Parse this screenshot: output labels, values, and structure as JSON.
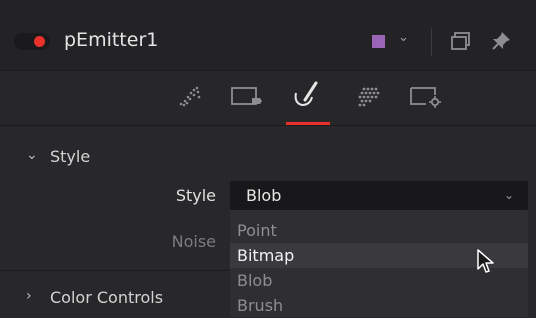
{
  "header": {
    "node_name": "pEmitter1",
    "swatch_color": "#9a65b6",
    "toggle_color": "#e8312a"
  },
  "tabs": [
    {
      "icon": "particles-icon",
      "active": false
    },
    {
      "icon": "region-icon",
      "active": false
    },
    {
      "icon": "brush-icon",
      "active": true
    },
    {
      "icon": "sets-icon",
      "active": false
    },
    {
      "icon": "settings-icon",
      "active": false
    }
  ],
  "style_section": {
    "title": "Style",
    "style_label": "Style",
    "style_value": "Blob",
    "noise_label": "Noise",
    "options": [
      "Point",
      "Bitmap",
      "Blob",
      "Brush"
    ],
    "highlighted": "Bitmap"
  },
  "color_section": {
    "title": "Color Controls"
  },
  "colors": {
    "accent": "#e8312a",
    "background": "#28282b"
  }
}
